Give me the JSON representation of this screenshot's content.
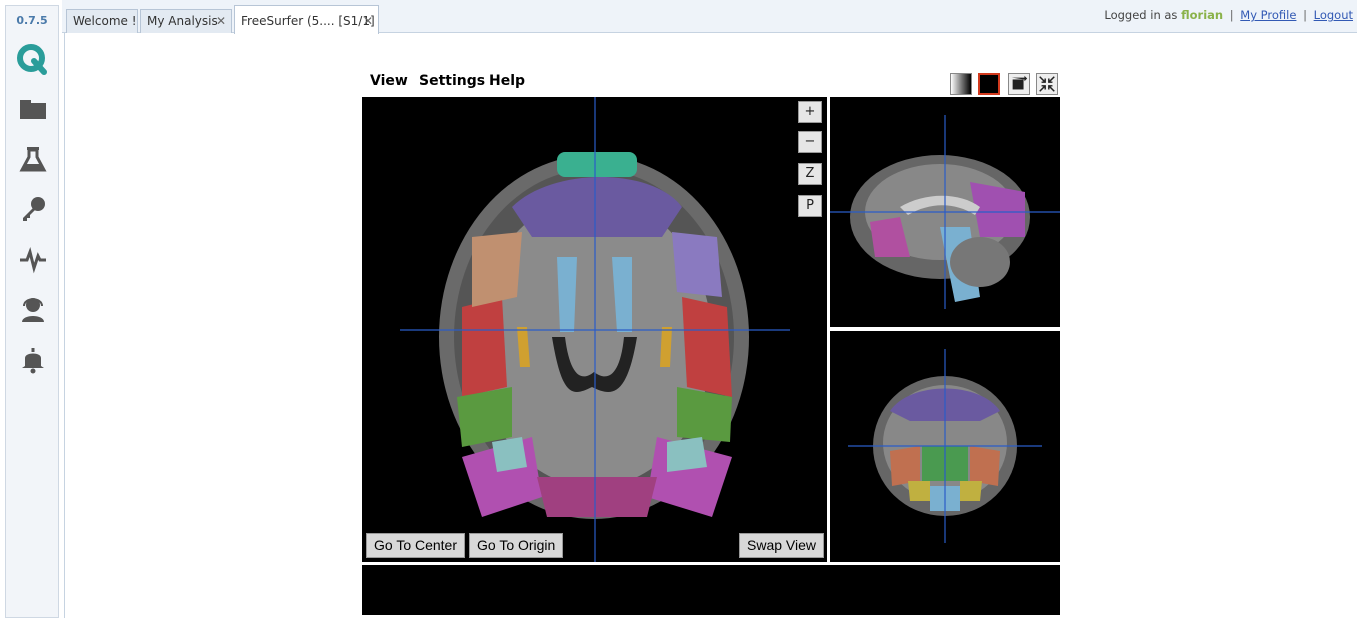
{
  "app": {
    "version": "0.7.5"
  },
  "tabs": [
    {
      "label": "Welcome !"
    },
    {
      "label": "My Analysis"
    },
    {
      "label": "FreeSurfer (5.... [S1/1]"
    }
  ],
  "account": {
    "prefix": "Logged in as",
    "username": "florian",
    "profile_link": "My Profile",
    "logout_link": "Logout"
  },
  "sidebar": {
    "icons": [
      "folder-icon",
      "flask-icon",
      "key-icon",
      "pulse-icon",
      "support-agent-icon",
      "bell-icon"
    ]
  },
  "viewer": {
    "menus": [
      "View",
      "Settings",
      "Help"
    ],
    "zoom_in": "+",
    "zoom_out": "−",
    "z_button": "Z",
    "p_button": "P",
    "go_to_center": "Go To Center",
    "go_to_origin": "Go To Origin",
    "swap_view": "Swap View"
  },
  "colors": {
    "crosshair": "#2a5cc8",
    "accent": "#3aa0a0",
    "selected_toolbar": "#d23a1e"
  }
}
